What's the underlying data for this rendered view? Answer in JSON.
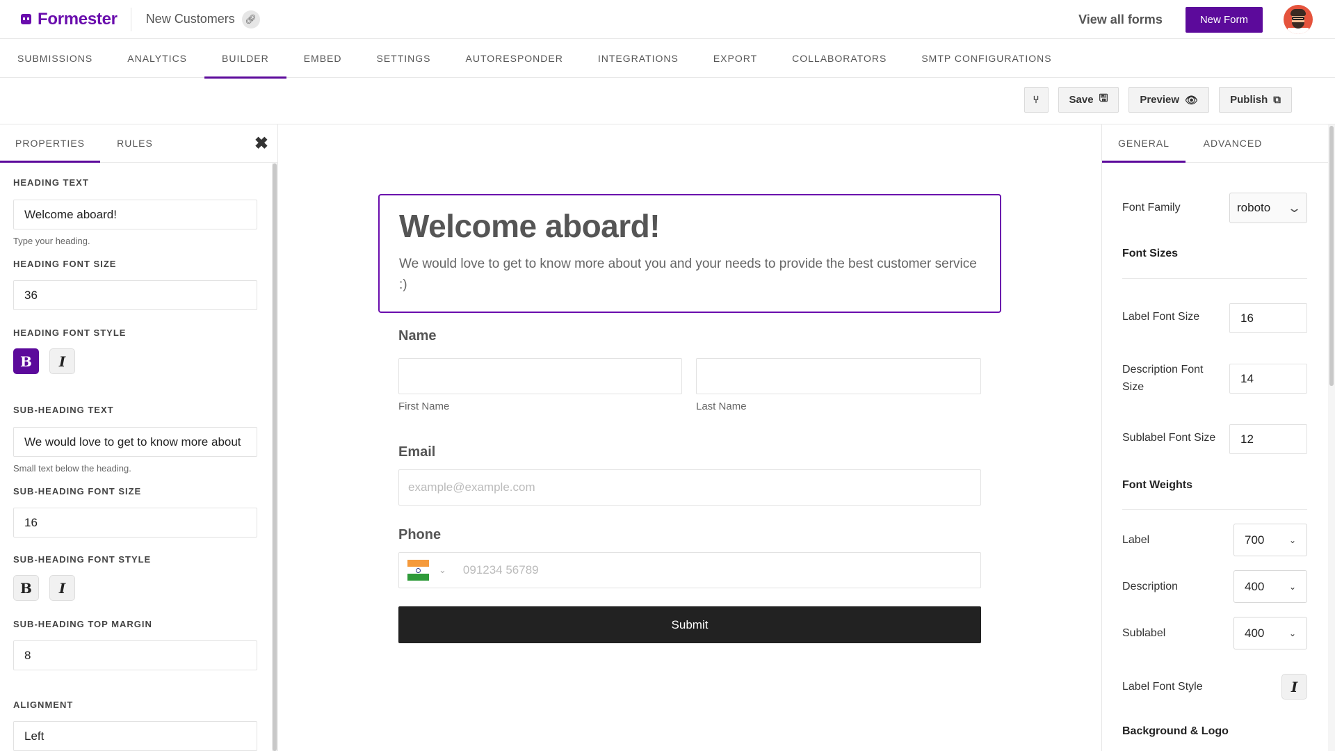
{
  "app": {
    "logo": "Formester",
    "form_title": "New Customers"
  },
  "topbar": {
    "view_all": "View all forms",
    "new_form": "New Form"
  },
  "nav_tabs": [
    "SUBMISSIONS",
    "ANALYTICS",
    "BUILDER",
    "EMBED",
    "SETTINGS",
    "AUTORESPONDER",
    "INTEGRATIONS",
    "EXPORT",
    "COLLABORATORS",
    "SMTP CONFIGURATIONS"
  ],
  "nav_active": "BUILDER",
  "toolbar": {
    "save": "Save",
    "preview": "Preview",
    "publish": "Publish"
  },
  "left_panel": {
    "tabs": [
      "PROPERTIES",
      "RULES"
    ],
    "heading_text_label": "HEADING TEXT",
    "heading_text_value": "Welcome aboard!",
    "heading_text_help": "Type your heading.",
    "heading_font_size_label": "HEADING FONT SIZE",
    "heading_font_size_value": "36",
    "heading_font_style_label": "HEADING FONT STYLE",
    "sub_heading_text_label": "SUB-HEADING TEXT",
    "sub_heading_text_value": "We would love to get to know more about",
    "sub_heading_text_help": "Small text below the heading.",
    "sub_heading_font_size_label": "SUB-HEADING FONT SIZE",
    "sub_heading_font_size_value": "16",
    "sub_heading_font_style_label": "SUB-HEADING FONT STYLE",
    "sub_heading_top_margin_label": "SUB-HEADING TOP MARGIN",
    "sub_heading_top_margin_value": "8",
    "alignment_label": "ALIGNMENT",
    "alignment_value": "Left",
    "bold_glyph": "B",
    "italic_glyph": "I"
  },
  "form": {
    "heading": "Welcome aboard!",
    "sub_heading": "We would love to get to know more about you and your needs to provide the best customer service :)",
    "name_label": "Name",
    "first_name_sublabel": "First Name",
    "last_name_sublabel": "Last Name",
    "email_label": "Email",
    "email_placeholder": "example@example.com",
    "phone_label": "Phone",
    "phone_placeholder": "091234 56789",
    "submit": "Submit"
  },
  "right_panel": {
    "tabs": [
      "GENERAL",
      "ADVANCED"
    ],
    "font_family_label": "Font Family",
    "font_family_value": "roboto",
    "font_sizes_heading": "Font Sizes",
    "label_font_size_label": "Label Font Size",
    "label_font_size_value": "16",
    "description_font_size_label": "Description Font Size",
    "description_font_size_value": "14",
    "sublabel_font_size_label": "Sublabel Font Size",
    "sublabel_font_size_value": "12",
    "font_weights_heading": "Font Weights",
    "label_weight_label": "Label",
    "label_weight_value": "700",
    "description_weight_label": "Description",
    "description_weight_value": "400",
    "sublabel_weight_label": "Sublabel",
    "sublabel_weight_value": "400",
    "label_font_style_label": "Label Font Style",
    "italic_glyph": "I",
    "background_logo_heading": "Background & Logo"
  },
  "colors": {
    "accent": "#5c0a9b",
    "brand": "#6a0dad",
    "submit_bg": "#222222"
  },
  "icons": {
    "link": "link-icon",
    "close": "close-icon",
    "save": "floppy-disk-icon",
    "preview": "eye-icon",
    "publish": "external-link-icon",
    "flag": "india-flag-icon"
  }
}
